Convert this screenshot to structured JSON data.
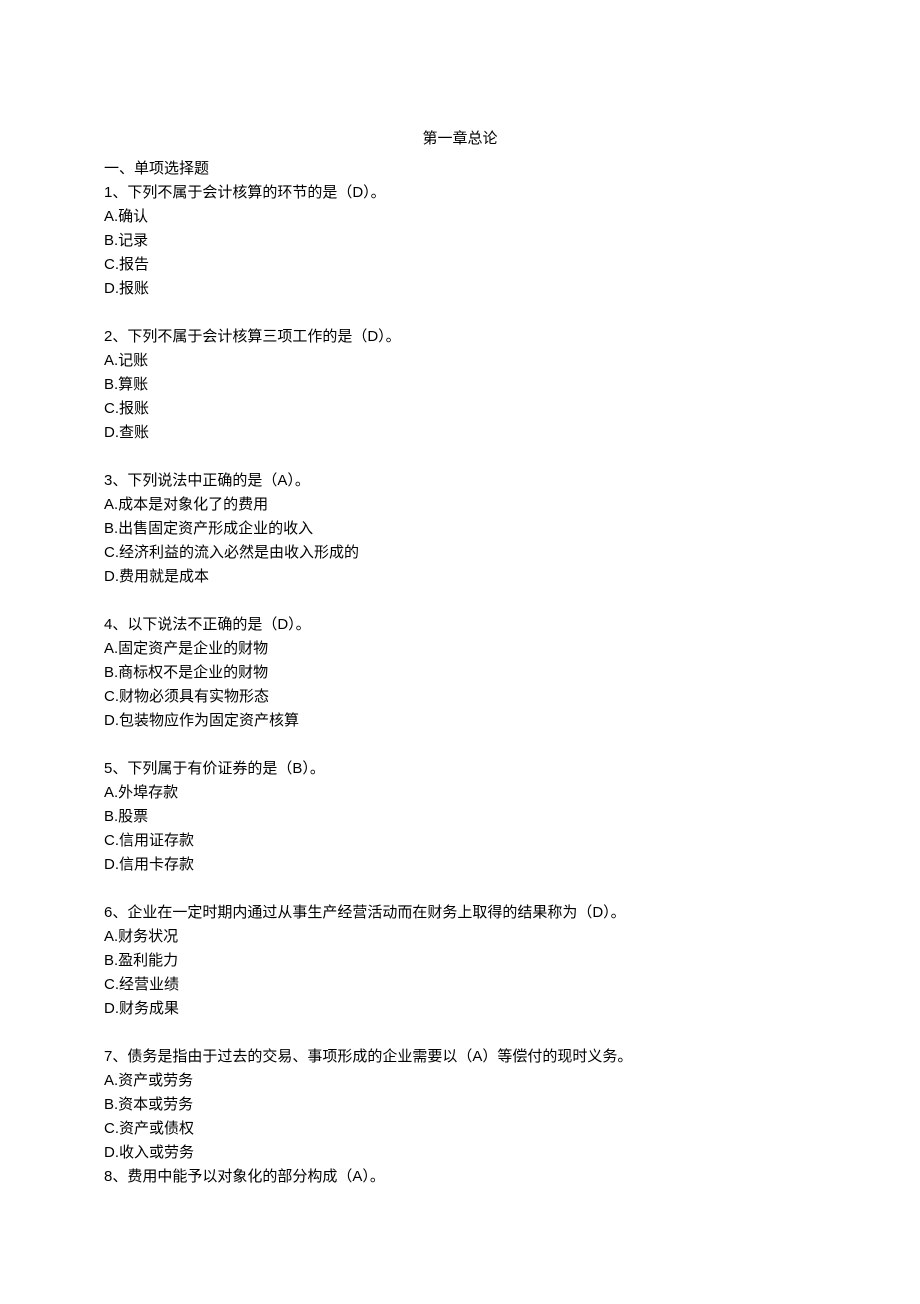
{
  "title": "第一章总论",
  "section_heading": "一、单项选择题",
  "questions": [
    {
      "stem": "1、下列不属于会计核算的环节的是（D）。",
      "options": [
        "A.确认",
        "B.记录",
        "C.报告",
        "D.报账"
      ]
    },
    {
      "stem": "2、下列不属于会计核算三项工作的是（D）。",
      "options": [
        "A.记账",
        "B.算账",
        "C.报账",
        "D.查账"
      ]
    },
    {
      "stem": "3、下列说法中正确的是（A）。",
      "options": [
        "A.成本是对象化了的费用",
        "B.出售固定资产形成企业的收入",
        "C.经济利益的流入必然是由收入形成的",
        "D.费用就是成本"
      ]
    },
    {
      "stem": "4、以下说法不正确的是（D）。",
      "options": [
        "A.固定资产是企业的财物",
        "B.商标权不是企业的财物",
        "C.财物必须具有实物形态",
        "D.包装物应作为固定资产核算"
      ]
    },
    {
      "stem": "5、下列属于有价证券的是（B）。",
      "options": [
        "A.外埠存款",
        "B.股票",
        "C.信用证存款",
        "D.信用卡存款"
      ]
    },
    {
      "stem": "6、企业在一定时期内通过从事生产经营活动而在财务上取得的结果称为（D）。",
      "options": [
        "A.财务状况",
        "B.盈利能力",
        "C.经营业绩",
        "D.财务成果"
      ]
    },
    {
      "stem": "7、债务是指由于过去的交易、事项形成的企业需要以（A）等偿付的现时义务。",
      "options": [
        "A.资产或劳务",
        "B.资本或劳务",
        "C.资产或债权",
        "D.收入或劳务"
      ]
    }
  ],
  "trailing_line": "8、费用中能予以对象化的部分构成（A）。"
}
